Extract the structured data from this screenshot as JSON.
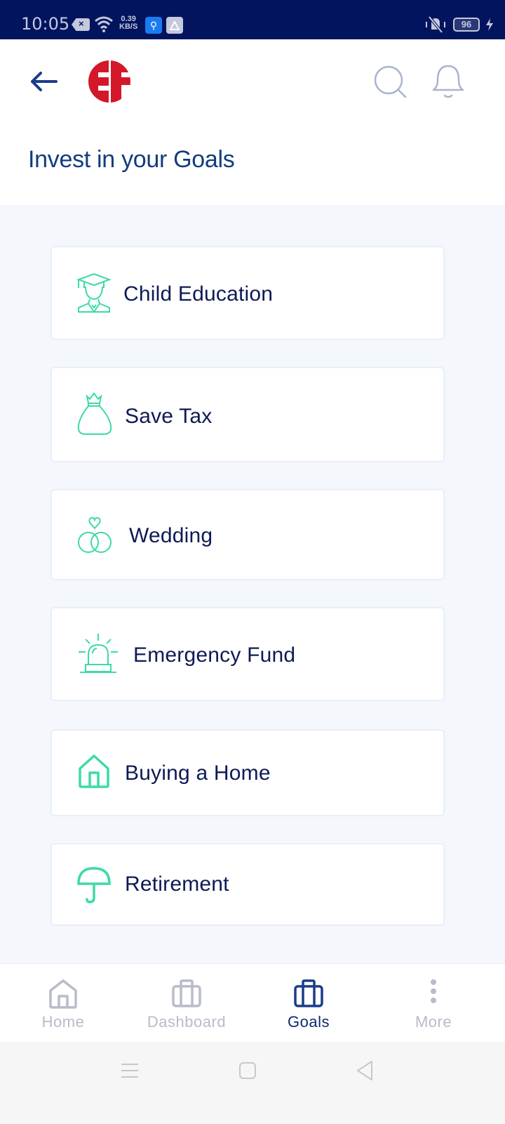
{
  "status_bar": {
    "time": "10:05",
    "net_speed_value": "0.39",
    "net_speed_unit": "KB/S",
    "battery_level": "96",
    "icons": [
      "close-notification-icon",
      "wifi-icon",
      "usb-icon",
      "accessibility-icon",
      "mute-vibrate-icon",
      "battery-icon",
      "charging-icon"
    ]
  },
  "header": {
    "back_icon": "arrow-left-icon",
    "logo_text": "EF",
    "search_icon": "search-icon",
    "notification_icon": "bell-icon",
    "title": "Invest in your Goals"
  },
  "colors": {
    "brand_red": "#d4182a",
    "primary_blue": "#123d7c",
    "goal_icon_green": "#3ddba3",
    "text_dark": "#0e1a55",
    "nav_inactive": "#b8bcca",
    "status_bar_bg": "#03145f"
  },
  "goals": [
    {
      "label": "Child Education",
      "icon": "graduate-icon"
    },
    {
      "label": "Save Tax",
      "icon": "money-bag-icon"
    },
    {
      "label": "Wedding",
      "icon": "wedding-rings-icon"
    },
    {
      "label": "Emergency Fund",
      "icon": "siren-icon"
    },
    {
      "label": "Buying a Home",
      "icon": "house-icon"
    },
    {
      "label": "Retirement",
      "icon": "umbrella-icon"
    }
  ],
  "bottom_nav": {
    "items": [
      {
        "label": "Home",
        "icon": "home-icon",
        "active": false
      },
      {
        "label": "Dashboard",
        "icon": "briefcase-icon",
        "active": false
      },
      {
        "label": "Goals",
        "icon": "briefcase-icon",
        "active": true
      },
      {
        "label": "More",
        "icon": "more-vertical-icon",
        "active": false
      }
    ]
  },
  "system_nav": {
    "icons": [
      "recents-menu-icon",
      "home-square-icon",
      "back-triangle-icon"
    ]
  }
}
